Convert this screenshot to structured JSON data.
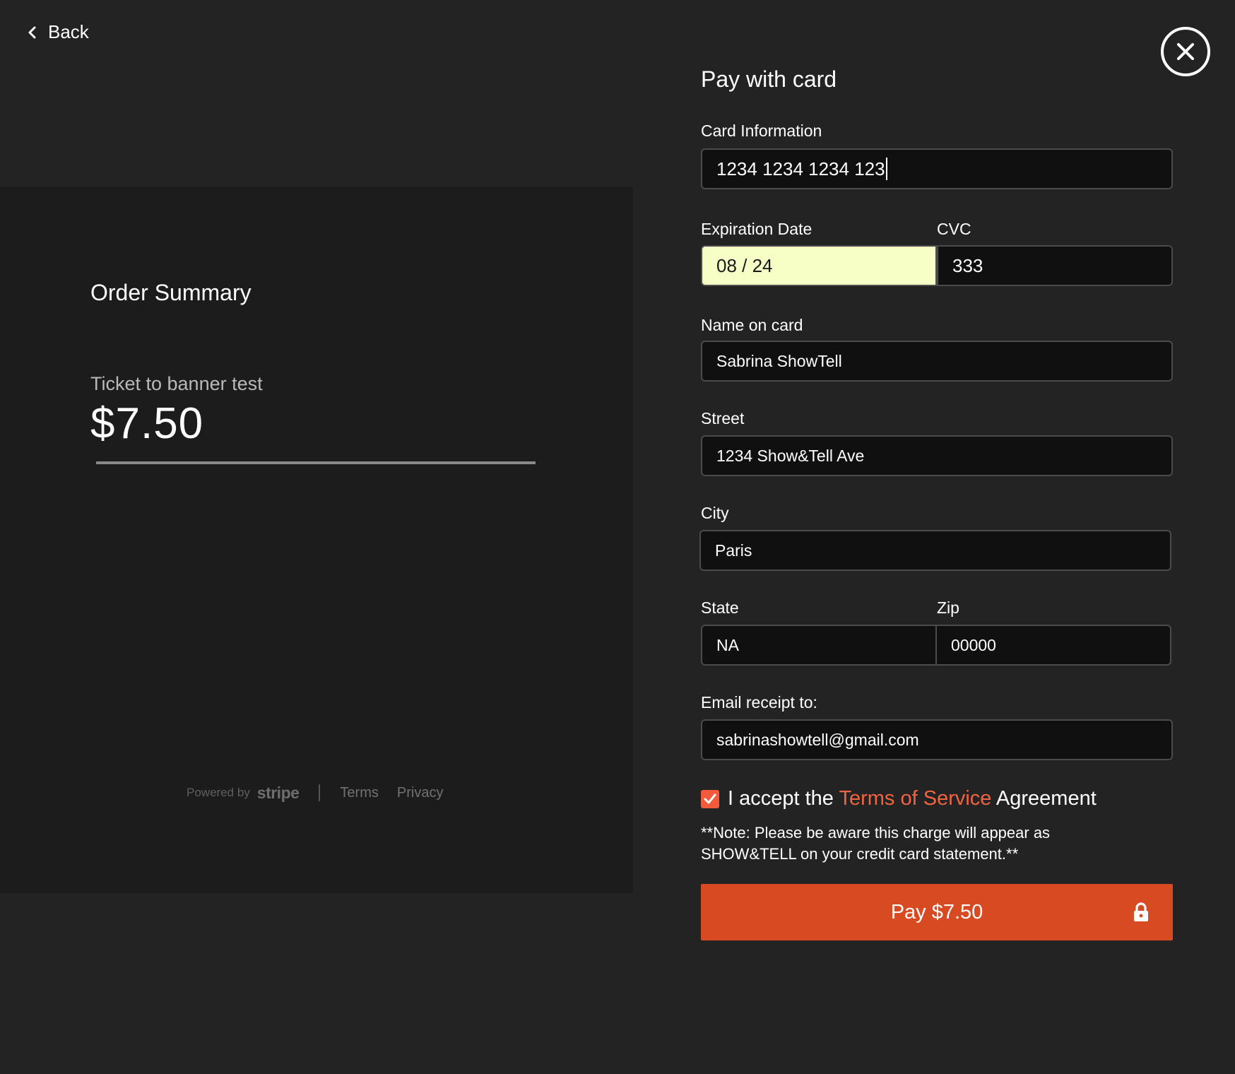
{
  "nav": {
    "back_label": "Back"
  },
  "summary": {
    "title": "Order Summary",
    "item_name": "Ticket to banner test",
    "item_price": "$7.50",
    "footer": {
      "powered_by": "Powered by",
      "brand": "stripe",
      "terms": "Terms",
      "privacy": "Privacy"
    }
  },
  "form": {
    "title": "Pay with card",
    "card_info": {
      "label": "Card Information",
      "value": "1234 1234 1234 123"
    },
    "expiration": {
      "label": "Expiration Date",
      "value": "08 / 24"
    },
    "cvc": {
      "label": "CVC",
      "value": "333"
    },
    "name": {
      "label": "Name on card",
      "value": "Sabrina ShowTell"
    },
    "street": {
      "label": "Street",
      "value": "1234 Show&Tell Ave"
    },
    "city": {
      "label": "City",
      "value": "Paris"
    },
    "state": {
      "label": "State",
      "value": "NA"
    },
    "zip": {
      "label": "Zip",
      "value": "00000"
    },
    "email": {
      "label": "Email receipt to:",
      "value": "sabrinashowtell@gmail.com"
    },
    "terms": {
      "checked": true,
      "prefix": "I accept the",
      "link": "Terms of Service",
      "suffix": "Agreement"
    },
    "note": "**Note: Please be aware this charge will appear as SHOW&TELL on your credit card statement.**",
    "pay_label": "Pay $7.50"
  },
  "colors": {
    "accent": "#d84a22",
    "link": "#f06442",
    "autofill": "#f7ffc6",
    "background": "#232323",
    "panel": "#1c1c1c"
  }
}
